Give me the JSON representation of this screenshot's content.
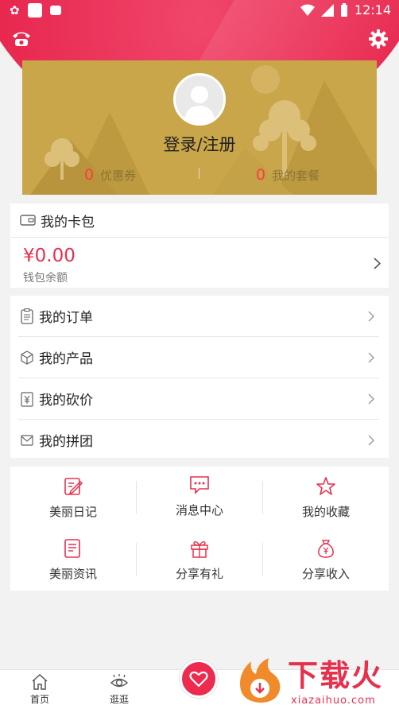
{
  "status_bar": {
    "time": "12:14"
  },
  "profile": {
    "login_label": "登录/注册",
    "coupons": {
      "count": "0",
      "label": "优惠券"
    },
    "packages": {
      "count": "0",
      "label": "我的套餐"
    }
  },
  "wallet": {
    "title": "我的卡包",
    "amount": "¥0.00",
    "balance_label": "钱包余额"
  },
  "menu": {
    "items": [
      {
        "label": "我的订单",
        "icon": "clipboard-icon"
      },
      {
        "label": "我的产品",
        "icon": "cube-icon"
      },
      {
        "label": "我的砍价",
        "icon": "yen-tag-icon"
      },
      {
        "label": "我的拼团",
        "icon": "envelope-icon"
      }
    ]
  },
  "shortcuts": {
    "items": [
      {
        "label": "美丽日记",
        "icon": "edit-note-icon"
      },
      {
        "label": "消息中心",
        "icon": "chat-bubble-icon"
      },
      {
        "label": "我的收藏",
        "icon": "star-icon"
      },
      {
        "label": "美丽资讯",
        "icon": "news-icon"
      },
      {
        "label": "分享有礼",
        "icon": "gift-icon"
      },
      {
        "label": "分享收入",
        "icon": "money-bag-icon"
      }
    ]
  },
  "tabbar": {
    "home": "首页",
    "browse": "逛逛"
  },
  "watermark": {
    "text": "下载火",
    "url": "xiazaihuo.com"
  },
  "colors": {
    "accent": "#e8304d",
    "card": "#c9a64a"
  }
}
